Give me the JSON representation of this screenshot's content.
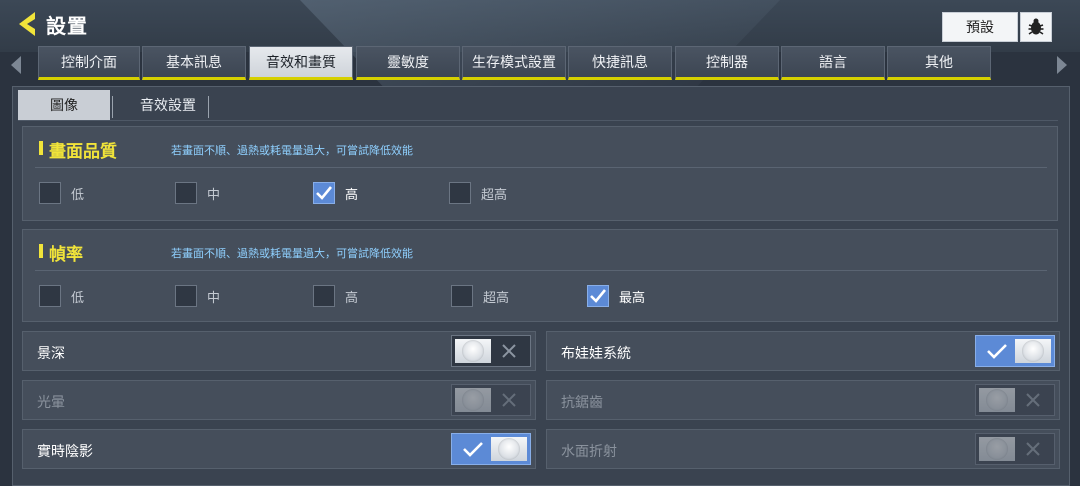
{
  "header": {
    "title": "設置",
    "preset_label": "預設",
    "back_icon": "back-arrow-icon",
    "bug_icon": "bug-icon"
  },
  "tabs": [
    {
      "label": "控制介面",
      "active": false
    },
    {
      "label": "基本訊息",
      "active": false
    },
    {
      "label": "音效和畫質",
      "active": true
    },
    {
      "label": "靈敏度",
      "active": false
    },
    {
      "label": "生存模式設置",
      "active": false
    },
    {
      "label": "快捷訊息",
      "active": false
    },
    {
      "label": "控制器",
      "active": false
    },
    {
      "label": "語言",
      "active": false
    },
    {
      "label": "其他",
      "active": false
    }
  ],
  "subtabs": [
    {
      "label": "圖像",
      "active": true
    },
    {
      "label": "音效設置",
      "active": false
    }
  ],
  "quality": {
    "title": "畫面品質",
    "hint": "若畫面不順、過熱或耗電量過大，可嘗試降低效能",
    "options": [
      {
        "label": "低",
        "checked": false
      },
      {
        "label": "中",
        "checked": false
      },
      {
        "label": "高",
        "checked": true
      },
      {
        "label": "超高",
        "checked": false
      }
    ]
  },
  "framerate": {
    "title": "幀率",
    "hint": "若畫面不順、過熱或耗電量過大，可嘗試降低效能",
    "options": [
      {
        "label": "低",
        "checked": false
      },
      {
        "label": "中",
        "checked": false
      },
      {
        "label": "高",
        "checked": false
      },
      {
        "label": "超高",
        "checked": false
      },
      {
        "label": "最高",
        "checked": true
      }
    ]
  },
  "toggles": {
    "depth_of_field": {
      "label": "景深",
      "on": false,
      "enabled": true
    },
    "ragdoll": {
      "label": "布娃娃系統",
      "on": true,
      "enabled": true
    },
    "bloom": {
      "label": "光暈",
      "on": false,
      "enabled": false
    },
    "anti_aliasing": {
      "label": "抗鋸齒",
      "on": false,
      "enabled": false
    },
    "realtime_shadow": {
      "label": "實時陰影",
      "on": true,
      "enabled": true
    },
    "water_refraction": {
      "label": "水面折射",
      "on": false,
      "enabled": false
    }
  },
  "colors": {
    "accent_yellow": "#f1e43a",
    "checked_blue": "#5c8ad6",
    "hint_blue": "#8fd0ff"
  }
}
